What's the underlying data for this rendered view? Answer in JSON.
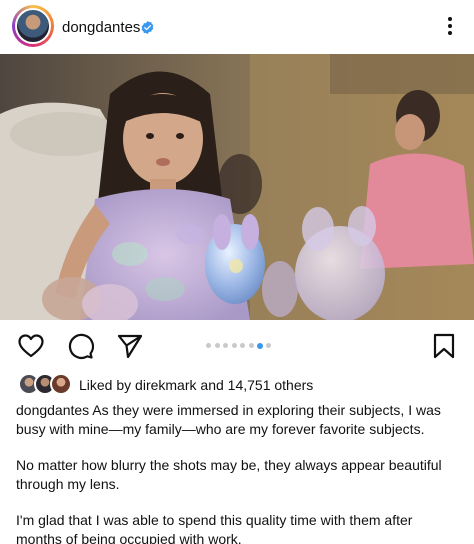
{
  "header": {
    "username": "dongdantes",
    "verified_icon": "verified-badge-icon",
    "more_icon": "more-vertical-icon"
  },
  "post": {
    "carousel_total": 8,
    "carousel_active": 7
  },
  "actions": {
    "like_icon": "heart-icon",
    "comment_icon": "comment-icon",
    "share_icon": "send-icon",
    "save_icon": "bookmark-icon"
  },
  "likes": {
    "prefix": "Liked by ",
    "user": "direkmark",
    "middle": " and ",
    "count": "14,751 others"
  },
  "caption": {
    "username": "dongdantes",
    "line1": " As they were immersed in exploring their subjects, I was busy with mine—my family—who are my forever favorite subjects.",
    "para2": "No matter how blurry the shots may be, they always appear beautiful through my lens.",
    "para3": "I'm glad that I was able to spend this quality time with them after months of being occupied with work."
  },
  "colors": {
    "accent": "#3897f0",
    "inactive_dot": "#c9c9c9",
    "text": "#111111"
  }
}
